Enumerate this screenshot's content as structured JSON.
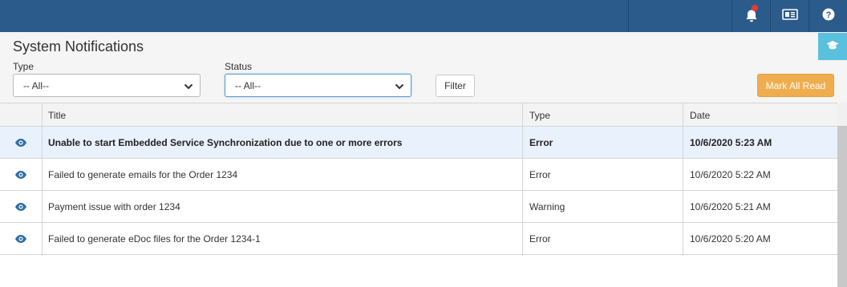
{
  "header": {
    "icons": [
      "bell-icon",
      "id-card-icon",
      "help-icon"
    ],
    "notification_dot_color": "#e53935",
    "bar_color": "#2b5b8b"
  },
  "page": {
    "title": "System Notifications",
    "side_icon": "graduation-cap-icon"
  },
  "filters": {
    "type_label": "Type",
    "type_value": "-- All--",
    "status_label": "Status",
    "status_value": "-- All--",
    "filter_button": "Filter",
    "mark_all_button": "Mark All Read",
    "accent": "#f0ad4e"
  },
  "table": {
    "columns": [
      "Title",
      "Type",
      "Date"
    ],
    "rows": [
      {
        "title": "Unable to start Embedded Service Synchronization due to one or more errors",
        "type": "Error",
        "date": "10/6/2020 5:23 AM",
        "unread": true
      },
      {
        "title": "Failed to generate emails for the Order 1234",
        "type": "Error",
        "date": "10/6/2020 5:22 AM",
        "unread": false
      },
      {
        "title": "Payment issue with order 1234",
        "type": "Warning",
        "date": "10/6/2020 5:21 AM",
        "unread": false
      },
      {
        "title": "Failed to generate eDoc files for the Order 1234-1",
        "type": "Error",
        "date": "10/6/2020 5:20 AM",
        "unread": false
      }
    ]
  }
}
